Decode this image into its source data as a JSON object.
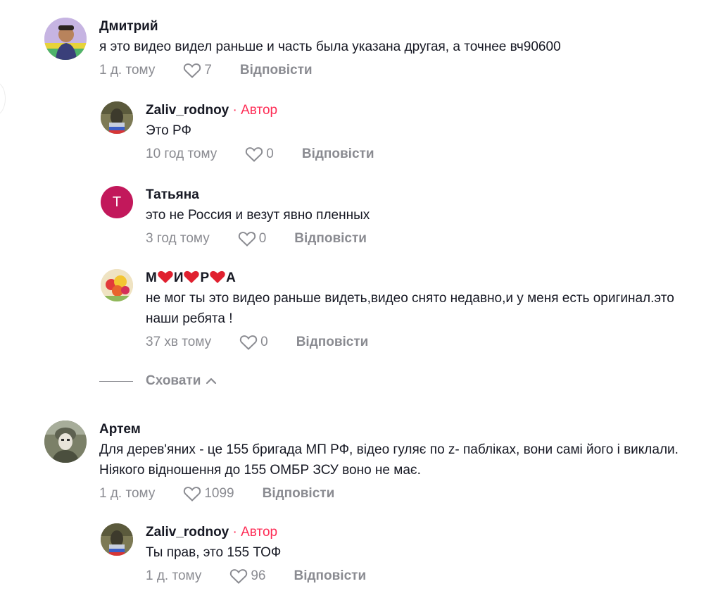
{
  "comments": [
    {
      "name": "Дмитрий",
      "text": "я это видео видел раньше и часть была указана другая, а точнее вч90600",
      "time": "1 д. тому",
      "likes": "7",
      "reply": "Відповісти",
      "replies": [
        {
          "name": "Zaliv_rodnoy",
          "author_tag": "· Автор",
          "text": "Это РФ",
          "time": "10 год тому",
          "likes": "0",
          "reply": "Відповісти"
        },
        {
          "name": "Татьяна",
          "avatar_letter": "T",
          "avatar_color": "#c2185b",
          "text": "это не Россия и везут явно пленных",
          "time": "3 год тому",
          "likes": "0",
          "reply": "Відповісти"
        },
        {
          "name_parts": [
            "М",
            "И",
            "Р",
            "А"
          ],
          "text": "не мог ты это видео раньше видеть,видео снято недавно,и у меня есть оригинал.это наши ребята !",
          "time": "37 хв тому",
          "likes": "0",
          "reply": "Відповісти"
        }
      ],
      "hide_label": "Сховати"
    },
    {
      "name": "Артем",
      "text": "Для дерев'яних - це 155 бригада МП РФ, відео гуляє по z- пабліках, вони самі його і виклали. Ніякого відношення до 155 ОМБР ЗСУ воно не має.",
      "time": "1 д. тому",
      "likes": "1099",
      "reply": "Відповісти",
      "replies": [
        {
          "name": "Zaliv_rodnoy",
          "author_tag": "· Автор",
          "text": "Ты прав, это 155 ТОФ",
          "time": "1 д. тому",
          "likes": "96",
          "reply": "Відповісти"
        }
      ]
    }
  ],
  "colors": {
    "author_accent": "#fe2c55",
    "muted": "#8a8b91",
    "heart_emoji": "#e0202f"
  },
  "icons": {
    "like": "heart-outline-icon",
    "hide": "chevron-up-icon"
  }
}
